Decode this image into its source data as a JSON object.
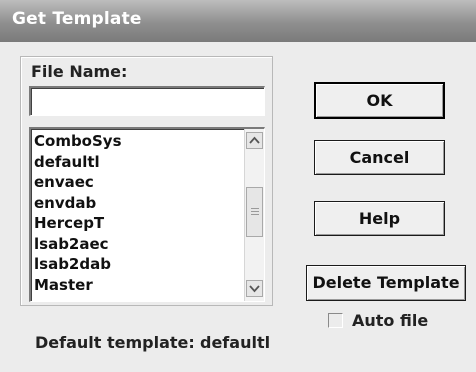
{
  "dialog": {
    "title": "Get Template"
  },
  "file_name": {
    "label": "File Name:",
    "value": ""
  },
  "templates": [
    "ComboSys",
    "defaultl",
    "envaec",
    "envdab",
    "HercepT",
    "lsab2aec",
    "lsab2dab",
    "Master"
  ],
  "buttons": {
    "ok": "OK",
    "cancel": "Cancel",
    "help": "Help",
    "delete_template": "Delete Template"
  },
  "auto_file": {
    "label": "Auto file",
    "checked": false
  },
  "default_template": {
    "label": "Default template:",
    "value": "defaultl"
  },
  "icons": {
    "scroll_up": "scroll-up-arrow-icon",
    "scroll_down": "scroll-down-arrow-icon"
  }
}
